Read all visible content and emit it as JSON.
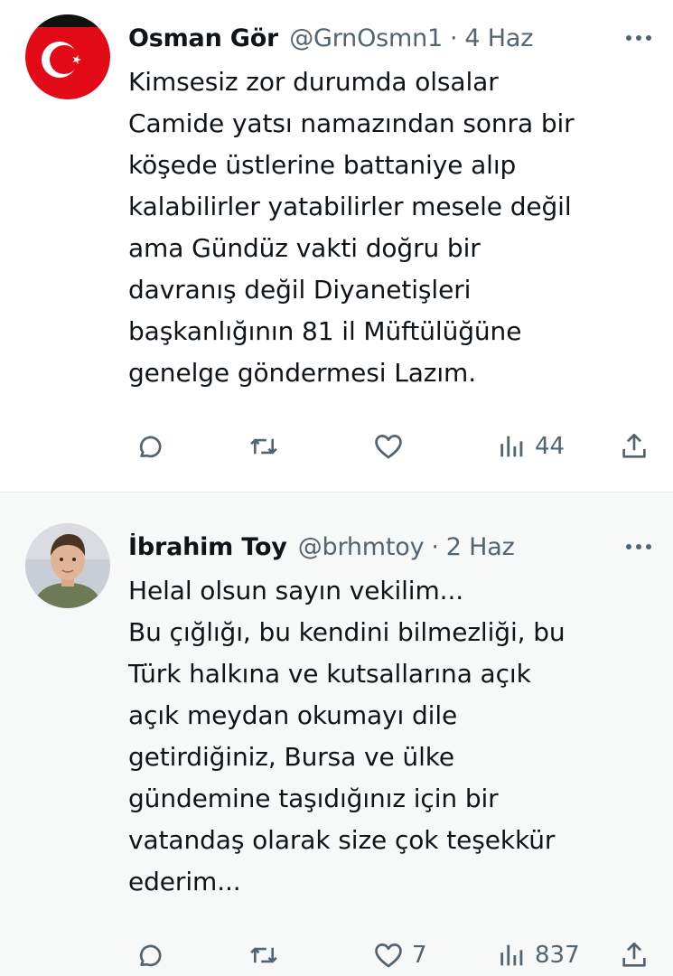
{
  "tweets": [
    {
      "avatar": "turkish-flag-avatar",
      "display_name": "Osman Gör",
      "handle": "@GrnOsmn1",
      "separator": "·",
      "time": "4 Haz",
      "body_lines": [
        "Kimsesiz zor durumda olsalar",
        "Camide yatsı namazından sonra bir",
        "köşede üstlerine battaniye alıp",
        "kalabilirler yatabilirler mesele değil",
        "ama Gündüz vakti doğru bir",
        "davranış değil Diyanetişleri",
        "başkanlığının 81 il Müftülüğüne",
        "genelge göndermesi Lazım."
      ],
      "likes": "",
      "views": "44"
    },
    {
      "avatar": "profile-photo-avatar",
      "display_name": "İbrahim Toy",
      "handle": "@brhmtoy",
      "separator": "·",
      "time": "2 Haz",
      "body_lines": [
        "Helal olsun sayın vekilim...",
        "Bu çığlığı, bu kendini bilmezliği, bu",
        "Türk halkına ve kutsallarına açık",
        "açık meydan okumayı dile",
        "getirdiğiniz, Bursa ve ülke",
        "gündemine taşıdığınız için bir",
        "vatandaş olarak size çok teşekkür",
        "ederim..."
      ],
      "likes": "7",
      "views": "837"
    }
  ],
  "colors": {
    "text": "#0f1419",
    "secondary": "#536471",
    "flag_red": "#e30a17",
    "row_highlight": "#f7f9f9"
  },
  "icons": [
    "more-icon",
    "reply-icon",
    "retweet-icon",
    "like-icon",
    "views-icon",
    "share-icon"
  ]
}
